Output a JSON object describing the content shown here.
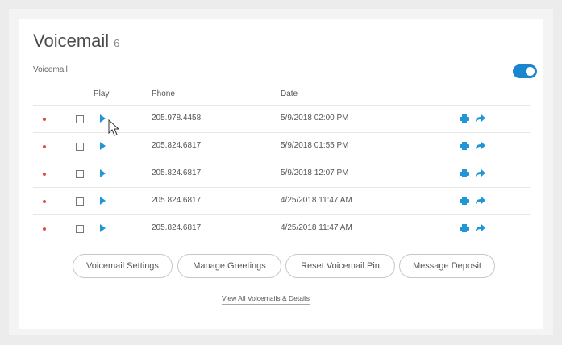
{
  "header": {
    "title": "Voicemail",
    "count": "6",
    "subtitle": "Voicemail"
  },
  "toggle": {
    "state": "on",
    "color": "#1a86d0"
  },
  "columns": {
    "play": "Play",
    "phone": "Phone",
    "date": "Date"
  },
  "rows": [
    {
      "phone": "205.978.4458",
      "date": "5/9/2018 02:00 PM",
      "unread": true
    },
    {
      "phone": "205.824.6817",
      "date": "5/9/2018 01:55 PM",
      "unread": true
    },
    {
      "phone": "205.824.6817",
      "date": "5/9/2018 12:07 PM",
      "unread": true
    },
    {
      "phone": "205.824.6817",
      "date": "4/25/2018 11:47 AM",
      "unread": true
    },
    {
      "phone": "205.824.6817",
      "date": "4/25/2018 11:47 AM",
      "unread": true
    }
  ],
  "actions": {
    "voicemail_settings": "Voicemail Settings",
    "manage_greetings": "Manage Greetings",
    "reset_pin": "Reset Voicemail Pin",
    "message_deposit": "Message Deposit"
  },
  "view_all_link": "View All Voicemails & Details",
  "icons": {
    "unread": "unread-dot-icon",
    "play": "play-icon",
    "print": "print-icon",
    "forward": "forward-icon"
  },
  "colors": {
    "accent": "#2196d6",
    "unread_dot": "#e04a4a"
  }
}
